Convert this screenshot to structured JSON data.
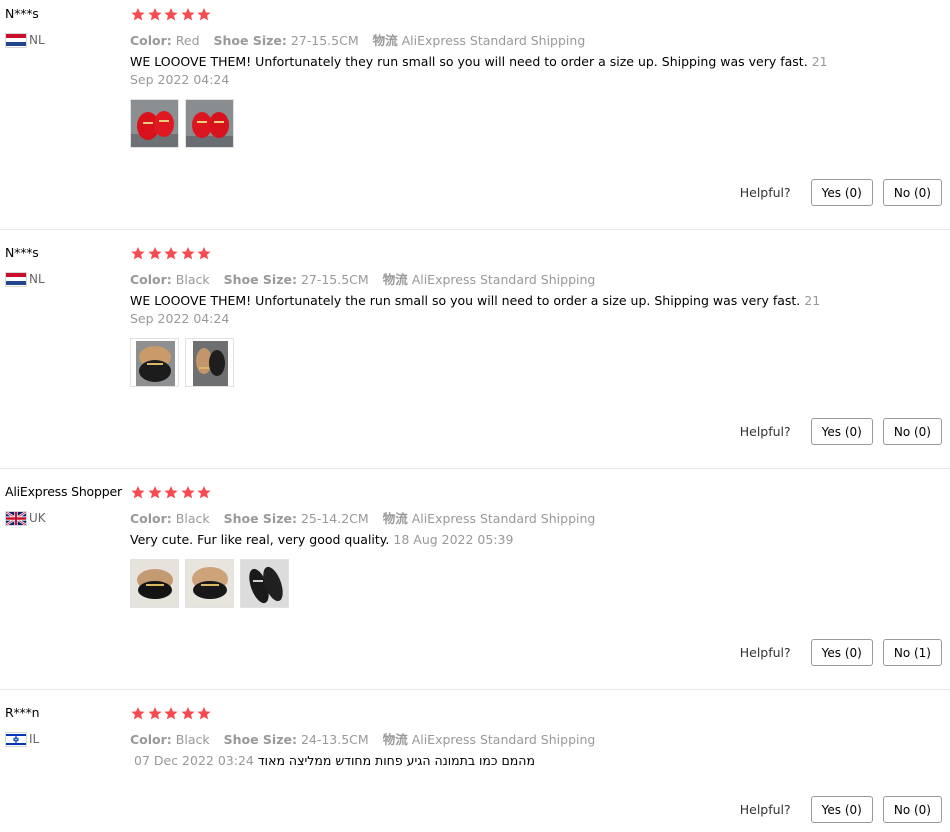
{
  "labels": {
    "color": "Color:",
    "shoe_size": "Shoe Size:",
    "shipping": "物流",
    "helpful": "Helpful?"
  },
  "reviews": [
    {
      "user": "N***s",
      "country": "NL",
      "flag": "netherlands-flag-icon",
      "stars": 5,
      "color": "Red",
      "shoe_size": "27-15.5CM",
      "shipping": "AliExpress Standard Shipping",
      "text": "WE LOOOVE THEM! Unfortunately they run small so you will need to order a size up. Shipping was very fast.",
      "date": "21 Sep 2022 04:24",
      "photos": [
        "red-slipper-photo",
        "red-slipper-photo"
      ],
      "yes": "Yes (0)",
      "no": "No (0)"
    },
    {
      "user": "N***s",
      "country": "NL",
      "flag": "netherlands-flag-icon",
      "stars": 5,
      "color": "Black",
      "shoe_size": "27-15.5CM",
      "shipping": "AliExpress Standard Shipping",
      "text": "WE LOOOVE THEM! Unfortunately the run small so you will need to order a size up. Shipping was very fast.",
      "date": "21 Sep 2022 04:24",
      "photos": [
        "black-fur-slipper-photo",
        "black-fur-slipper-photo"
      ],
      "yes": "Yes (0)",
      "no": "No (0)"
    },
    {
      "user": "AliExpress Shopper",
      "country": "UK",
      "flag": "uk-flag-icon",
      "stars": 5,
      "color": "Black",
      "shoe_size": "25-14.2CM",
      "shipping": "AliExpress Standard Shipping",
      "text": "Very cute. Fur like real, very good quality.",
      "date": "18 Aug 2022 05:39",
      "photos": [
        "fur-slipper-photo",
        "fur-slipper-photo",
        "black-sandal-photo"
      ],
      "yes": "Yes (0)",
      "no": "No (1)"
    },
    {
      "user": "R***n",
      "country": "IL",
      "flag": "israel-flag-icon",
      "stars": 5,
      "color": "Black",
      "shoe_size": "24-13.5CM",
      "shipping": "AliExpress Standard Shipping",
      "text": "מהמם כמו בתמונה הגיע פחות מחודש ממליצה מאוד",
      "date": "07 Dec 2022 03:24",
      "photos": [],
      "yes": "Yes (0)",
      "no": "No (0)"
    }
  ],
  "colors": {
    "star": "#f54b51",
    "muted": "#999999",
    "divider": "#e8e8e8"
  }
}
